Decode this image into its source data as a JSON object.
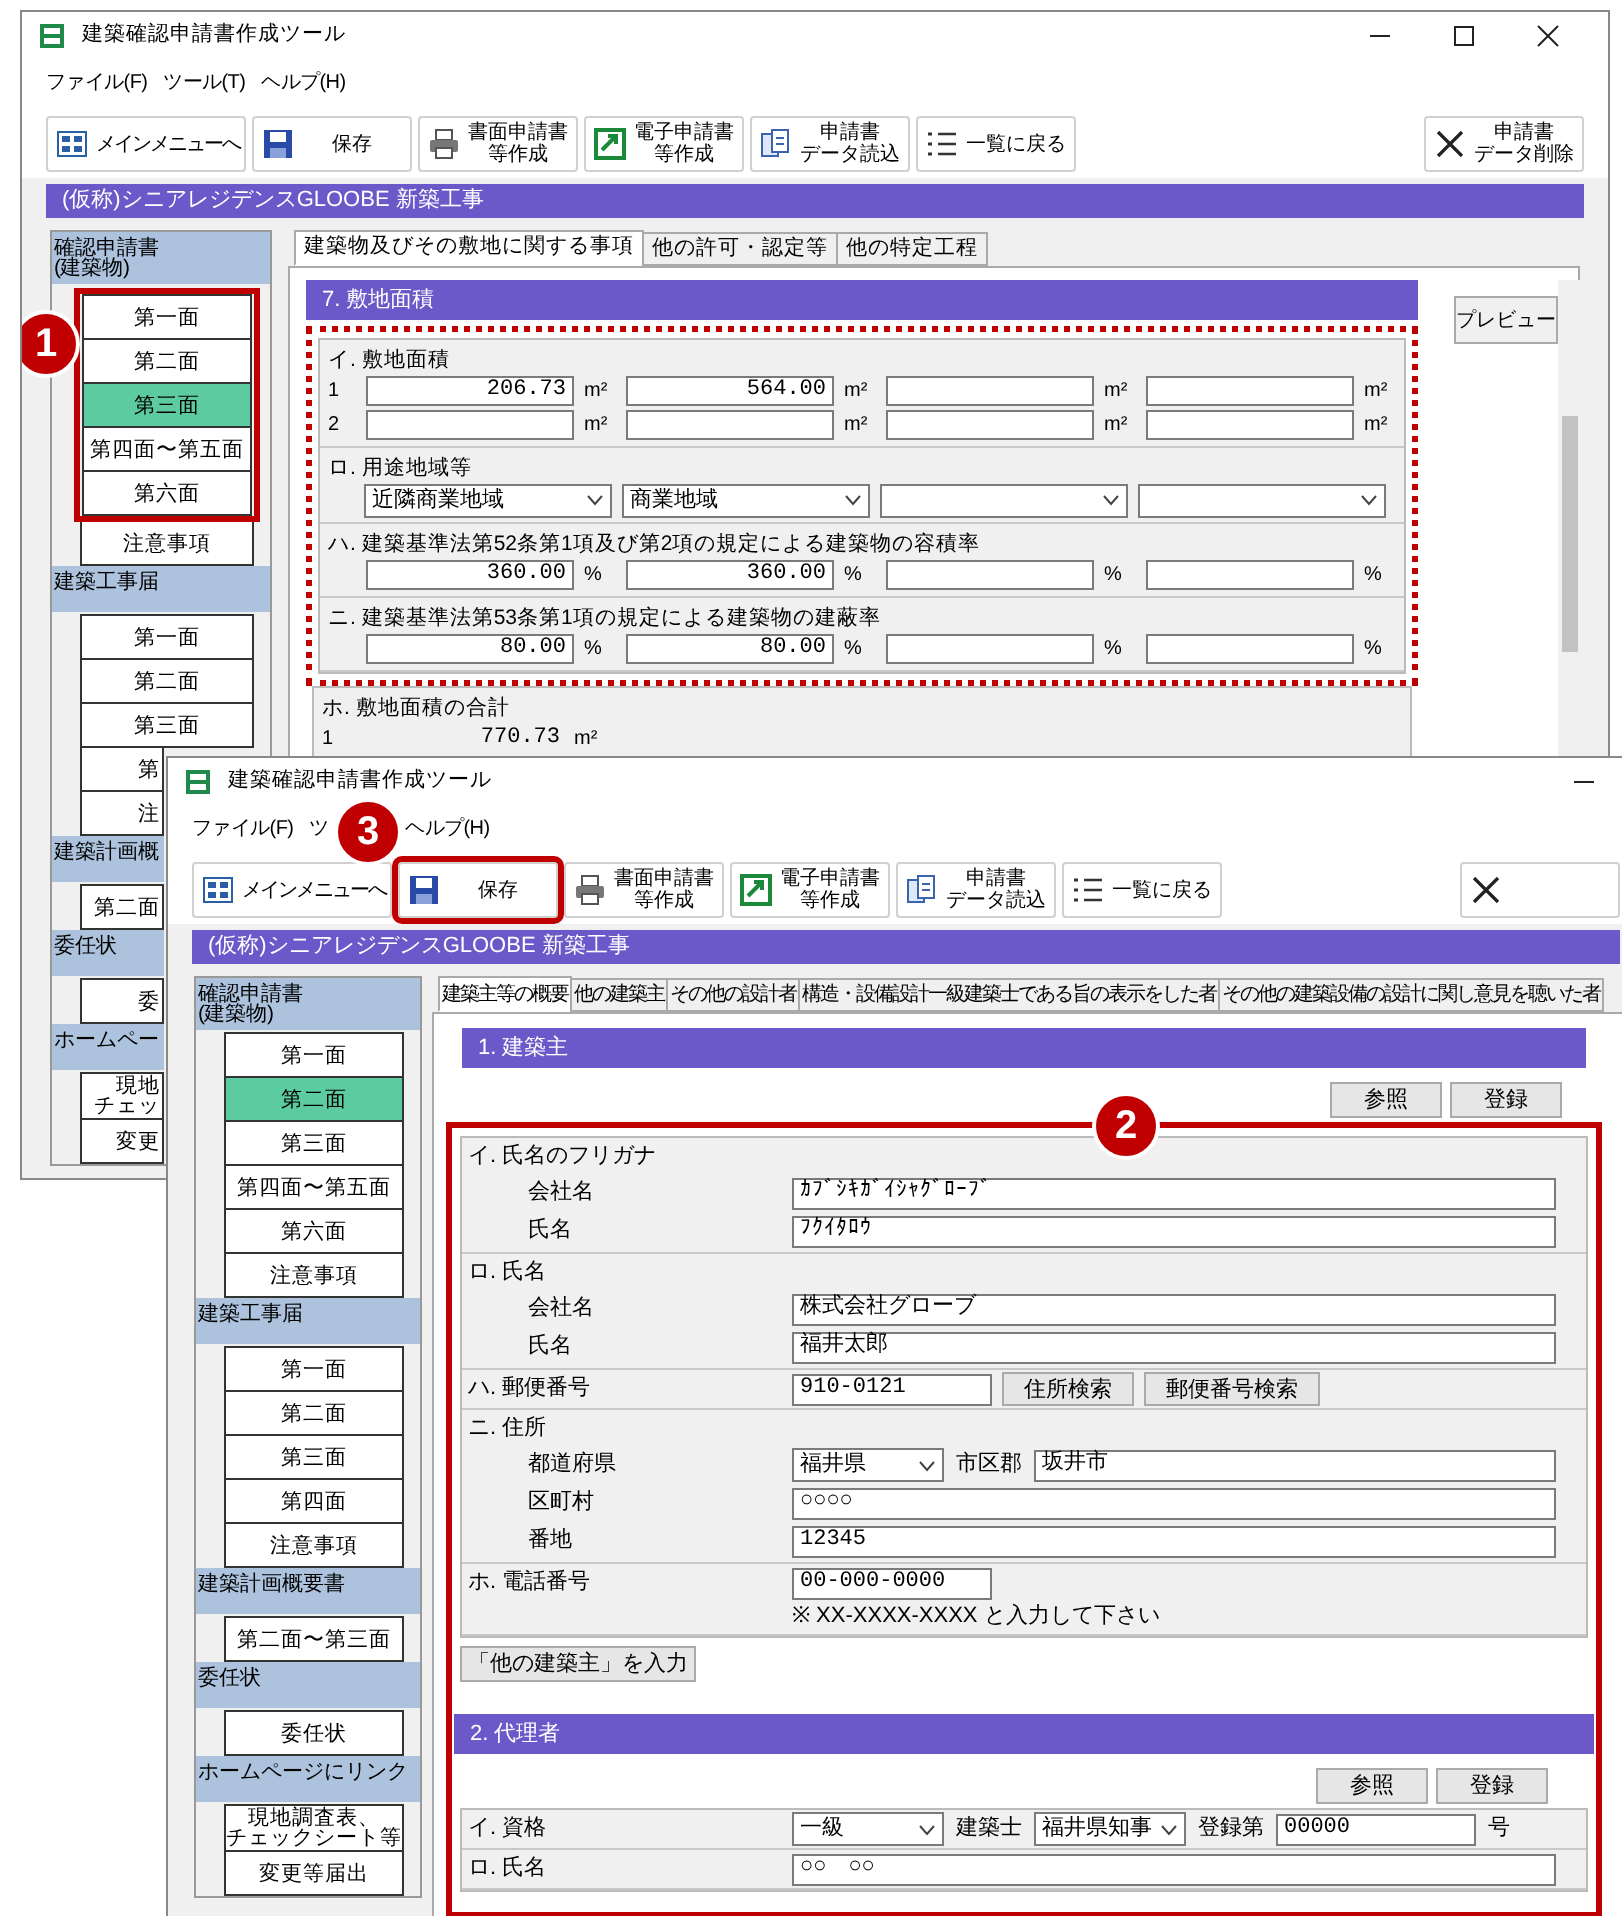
{
  "back_window": {
    "title": "建築確認申請書作成ツール",
    "menu": [
      "ファイル(F)",
      "ツール(T)",
      "ヘルプ(H)"
    ],
    "toolbar": [
      {
        "lines": [
          "メインメニューへ"
        ],
        "kind": "menu"
      },
      {
        "lines": [
          "保存"
        ],
        "kind": "save"
      },
      {
        "lines": [
          "書面申請書",
          "等作成"
        ],
        "kind": "print"
      },
      {
        "lines": [
          "電子申請書",
          "等作成"
        ],
        "kind": "export"
      },
      {
        "lines": [
          "申請書",
          "データ読込"
        ],
        "kind": "import"
      },
      {
        "lines": [
          "一覧に戻る"
        ],
        "kind": "list"
      },
      {
        "lines": [
          "申請書",
          "データ削除"
        ],
        "kind": "delete"
      }
    ],
    "project": "(仮称)シニアレジデンスGLOOBE 新築工事",
    "sidebar": [
      {
        "heading": [
          "確認申請書",
          "(建築物)"
        ],
        "callout": "1",
        "items": [
          {
            "lines": [
              "第一面"
            ],
            "selected": false,
            "highlighted": true
          },
          {
            "lines": [
              "第二面"
            ],
            "selected": false,
            "highlighted": true
          },
          {
            "lines": [
              "第三面"
            ],
            "selected": true,
            "highlighted": true
          },
          {
            "lines": [
              "第四面〜第五面"
            ],
            "selected": false,
            "highlighted": true
          },
          {
            "lines": [
              "第六面"
            ],
            "selected": false,
            "highlighted": true
          },
          {
            "lines": [
              "注意事項"
            ],
            "selected": false,
            "highlighted": false
          }
        ]
      },
      {
        "heading": [
          "建築工事届"
        ],
        "items": [
          {
            "lines": [
              "第一面"
            ],
            "selected": false
          },
          {
            "lines": [
              "第二面"
            ],
            "selected": false
          },
          {
            "lines": [
              "第三面"
            ],
            "selected": false
          },
          {
            "lines": [
              "第"
            ],
            "selected": false
          },
          {
            "lines": [
              "注"
            ],
            "selected": false
          }
        ]
      },
      {
        "heading": [
          "建築計画概"
        ],
        "items": [
          {
            "lines": [
              "第二面"
            ],
            "selected": false
          }
        ]
      },
      {
        "heading": [
          "委任状"
        ],
        "items": [
          {
            "lines": [
              "委"
            ],
            "selected": false
          }
        ]
      },
      {
        "heading": [
          "ホームペー"
        ],
        "items": [
          {
            "lines": [
              "現地",
              "チェッ"
            ],
            "selected": false
          },
          {
            "lines": [
              "変更"
            ],
            "selected": false
          }
        ]
      }
    ],
    "tabs": [
      {
        "label": "建築物及びその敷地に関する事項",
        "selected": true
      },
      {
        "label": "他の許可・認定等",
        "selected": false
      },
      {
        "label": "他の特定工程",
        "selected": false
      }
    ],
    "section_title": "7. 敷地面積",
    "preview_button": "プレビュー",
    "sections": [
      {
        "kind": "grid",
        "label": "イ. 敷地面積",
        "outlined": true,
        "rows": [
          {
            "number": "1",
            "cells": [
              {
                "value": "206.73",
                "unit": "m²"
              },
              {
                "value": "564.00",
                "unit": "m²"
              },
              {
                "unit": "m²"
              },
              {
                "unit": "m²"
              }
            ]
          },
          {
            "number": "2",
            "cells": [
              {
                "unit": "m²"
              },
              {
                "unit": "m²"
              },
              {
                "unit": "m²"
              },
              {
                "unit": "m²"
              }
            ]
          }
        ]
      },
      {
        "kind": "selects",
        "label": "ロ. 用途地域等",
        "outlined": true,
        "selects": [
          {
            "kind": "dropdown",
            "value": "近隣商業地域"
          },
          {
            "kind": "dropdown",
            "value": "商業地域"
          },
          {
            "kind": "dropdown"
          },
          {
            "kind": "dropdown"
          }
        ]
      },
      {
        "kind": "grid",
        "label": "ハ. 建築基準法第52条第1項及び第2項の規定による建築物の容積率",
        "outlined": true,
        "rows": [
          {
            "cells": [
              {
                "value": "360.00",
                "unit": "%"
              },
              {
                "value": "360.00",
                "unit": "%"
              },
              {
                "unit": "%"
              },
              {
                "unit": "%"
              }
            ]
          }
        ]
      },
      {
        "kind": "grid",
        "label": "ニ. 建築基準法第53条第1項の規定による建築物の建蔽率",
        "outlined": true,
        "rows": [
          {
            "cells": [
              {
                "value": "80.00",
                "unit": "%"
              },
              {
                "value": "80.00",
                "unit": "%"
              },
              {
                "unit": "%"
              },
              {
                "unit": "%"
              }
            ]
          }
        ]
      },
      {
        "kind": "total",
        "label": "ホ. 敷地面積の合計",
        "outlined": false,
        "rows": [
          {
            "number": "1",
            "value": "770.73",
            "unit": "m²"
          }
        ]
      }
    ]
  },
  "front_window": {
    "title": "建築確認申請書作成ツール",
    "menu": [
      "ファイル(F)",
      "ツ",
      "ヘルプ(H)"
    ],
    "toolbar": [
      {
        "lines": [
          "メインメニューへ"
        ],
        "kind": "menu"
      },
      {
        "lines": [
          "保存"
        ],
        "kind": "save",
        "callout": "3"
      },
      {
        "lines": [
          "書面申請書",
          "等作成"
        ],
        "kind": "print"
      },
      {
        "lines": [
          "電子申請書",
          "等作成"
        ],
        "kind": "export"
      },
      {
        "lines": [
          "申請書",
          "データ読込"
        ],
        "kind": "import"
      },
      {
        "lines": [
          "一覧に戻る"
        ],
        "kind": "list"
      },
      {
        "kind": "delete"
      }
    ],
    "project": "(仮称)シニアレジデンスGLOOBE 新築工事",
    "sidebar": [
      {
        "heading": [
          "確認申請書",
          "(建築物)"
        ],
        "items": [
          {
            "lines": [
              "第一面"
            ],
            "selected": false
          },
          {
            "lines": [
              "第二面"
            ],
            "selected": true
          },
          {
            "lines": [
              "第三面"
            ],
            "selected": false
          },
          {
            "lines": [
              "第四面〜第五面"
            ],
            "selected": false
          },
          {
            "lines": [
              "第六面"
            ],
            "selected": false
          },
          {
            "lines": [
              "注意事項"
            ],
            "selected": false
          }
        ]
      },
      {
        "heading": [
          "建築工事届"
        ],
        "items": [
          {
            "lines": [
              "第一面"
            ],
            "selected": false
          },
          {
            "lines": [
              "第二面"
            ],
            "selected": false
          },
          {
            "lines": [
              "第三面"
            ],
            "selected": false
          },
          {
            "lines": [
              "第四面"
            ],
            "selected": false
          },
          {
            "lines": [
              "注意事項"
            ],
            "selected": false
          }
        ]
      },
      {
        "heading": [
          "建築計画概要書"
        ],
        "items": [
          {
            "lines": [
              "第二面〜第三面"
            ],
            "selected": false
          }
        ]
      },
      {
        "heading": [
          "委任状"
        ],
        "items": [
          {
            "lines": [
              "委任状"
            ],
            "selected": false
          }
        ]
      },
      {
        "heading": [
          "ホームページにリンク"
        ],
        "items": [
          {
            "lines": [
              "現地調査表、",
              "チェックシート等"
            ],
            "selected": false
          },
          {
            "lines": [
              "変更等届出"
            ],
            "selected": false
          }
        ]
      }
    ],
    "tabs": [
      {
        "label": "建築主等の概要",
        "selected": true
      },
      {
        "label": "他の建築主",
        "selected": false
      },
      {
        "label": "その他の設計者",
        "selected": false
      },
      {
        "label": "構造・設備設計一級建築士である旨の表示をした者",
        "selected": false
      },
      {
        "label": "その他の建築設備の設計に関し意見を聴いた者",
        "selected": false
      }
    ],
    "callout": "2",
    "sections": [
      {
        "title": "1. 建築主",
        "buttons": [
          "参照",
          "登録"
        ],
        "groups": [
          {
            "heading": "イ. 氏名のフリガナ",
            "rows": [
              {
                "label": "会社名",
                "items": [
                  {
                    "kind": "input",
                    "value": "ｶﾌﾞｼｷｶﾞｲｼｬｸﾞﾛｰﾌﾞ"
                  }
                ]
              },
              {
                "label": "氏名",
                "items": [
                  {
                    "kind": "input",
                    "value": "ﾌｸｲﾀﾛｳ"
                  }
                ]
              }
            ]
          },
          {
            "heading": "ロ. 氏名",
            "rows": [
              {
                "label": "会社名",
                "items": [
                  {
                    "kind": "input",
                    "value": "株式会社グローブ"
                  }
                ]
              },
              {
                "label": "氏名",
                "items": [
                  {
                    "kind": "input",
                    "value": "福井太郎"
                  }
                ]
              }
            ]
          },
          {
            "heading": "ハ. 郵便番号",
            "inline": [
              {
                "kind": "short_input",
                "value": "910-0121"
              },
              {
                "kind": "button",
                "label": "住所検索"
              },
              {
                "kind": "button",
                "label": "郵便番号検索"
              }
            ]
          },
          {
            "heading": "ニ. 住所",
            "rows": [
              {
                "label": "都道府県",
                "items": [
                  {
                    "kind": "select",
                    "value": "福井県"
                  },
                  {
                    "kind": "text",
                    "label": "市区郡"
                  },
                  {
                    "kind": "input",
                    "value": "坂井市"
                  }
                ]
              },
              {
                "label": "区町村",
                "items": [
                  {
                    "kind": "input",
                    "value": "○○○○"
                  }
                ]
              },
              {
                "label": "番地",
                "items": [
                  {
                    "kind": "input",
                    "value": "12345"
                  }
                ]
              }
            ]
          },
          {
            "heading": "ホ. 電話番号",
            "inline": [
              {
                "kind": "short_input",
                "value": "00-000-0000"
              }
            ],
            "note": "※ XX-XXXX-XXXX と入力して下さい"
          }
        ],
        "extra_button": "「他の建築主」を入力"
      },
      {
        "title": "2. 代理者",
        "buttons": [
          "参照",
          "登録"
        ],
        "groups": [
          {
            "heading": "イ. 資格",
            "inline": [
              {
                "kind": "select",
                "value": "一級"
              },
              {
                "kind": "text",
                "label": "建築士"
              },
              {
                "kind": "select",
                "value": "福井県知事"
              },
              {
                "kind": "text",
                "label": "登録第"
              },
              {
                "kind": "short_input",
                "value": "00000"
              },
              {
                "kind": "text",
                "label": "号"
              }
            ]
          },
          {
            "heading": "ロ. 氏名",
            "inline": [
              {
                "kind": "input",
                "value": "○○　○○"
              }
            ]
          }
        ]
      }
    ]
  }
}
